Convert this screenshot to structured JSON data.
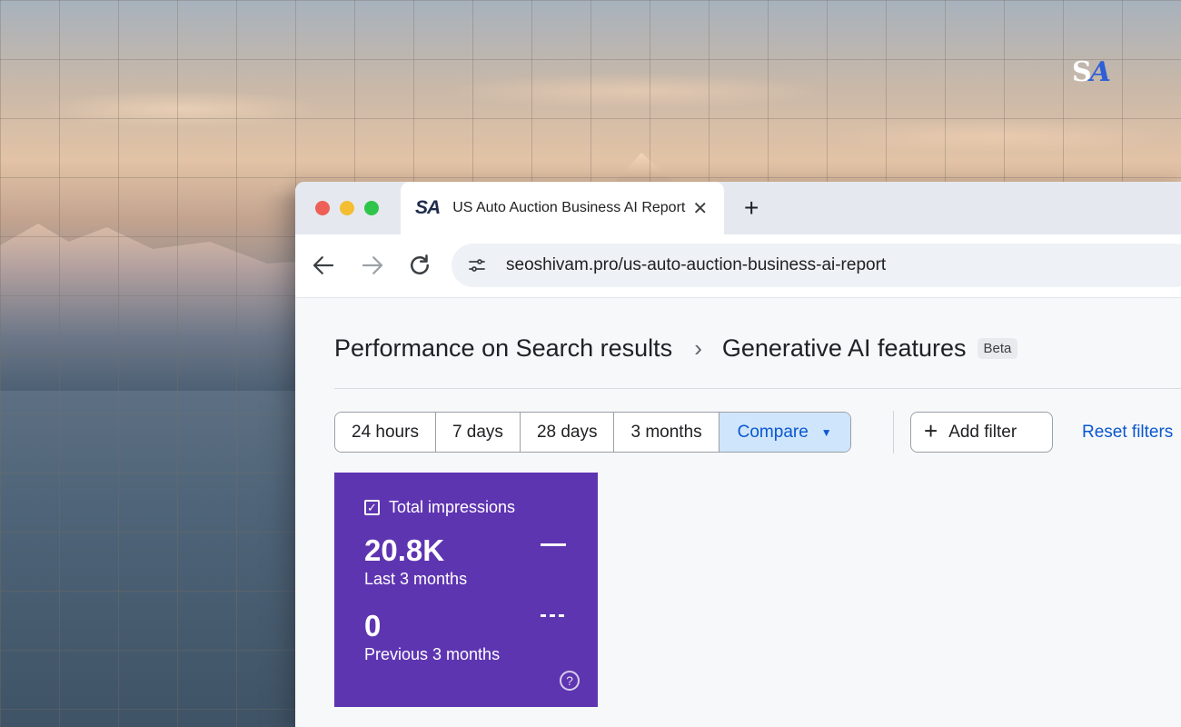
{
  "corner_logo": {
    "s": "S",
    "a": "A"
  },
  "tab": {
    "favicon_text": "SA",
    "title": "US Auto Auction Business AI Report",
    "close_glyph": "✕"
  },
  "new_tab_glyph": "+",
  "address_bar": {
    "url": "seoshivam.pro/us-auto-auction-business-ai-report"
  },
  "breadcrumb": {
    "parent": "Performance on Search results",
    "separator": "›",
    "current": "Generative AI features",
    "badge": "Beta"
  },
  "date_ranges": [
    "24 hours",
    "7 days",
    "28 days",
    "3 months"
  ],
  "compare_label": "Compare",
  "add_filter_label": "Add filter",
  "reset_filters_label": "Reset filters",
  "metric_card": {
    "title": "Total impressions",
    "current_value": "20.8K",
    "current_label": "Last 3 months",
    "previous_value": "0",
    "previous_label": "Previous 3 months",
    "help_glyph": "?",
    "color": "#5e35b1"
  },
  "colors": {
    "accent": "#0b57d0",
    "compare_bg": "#cfe5fb"
  }
}
